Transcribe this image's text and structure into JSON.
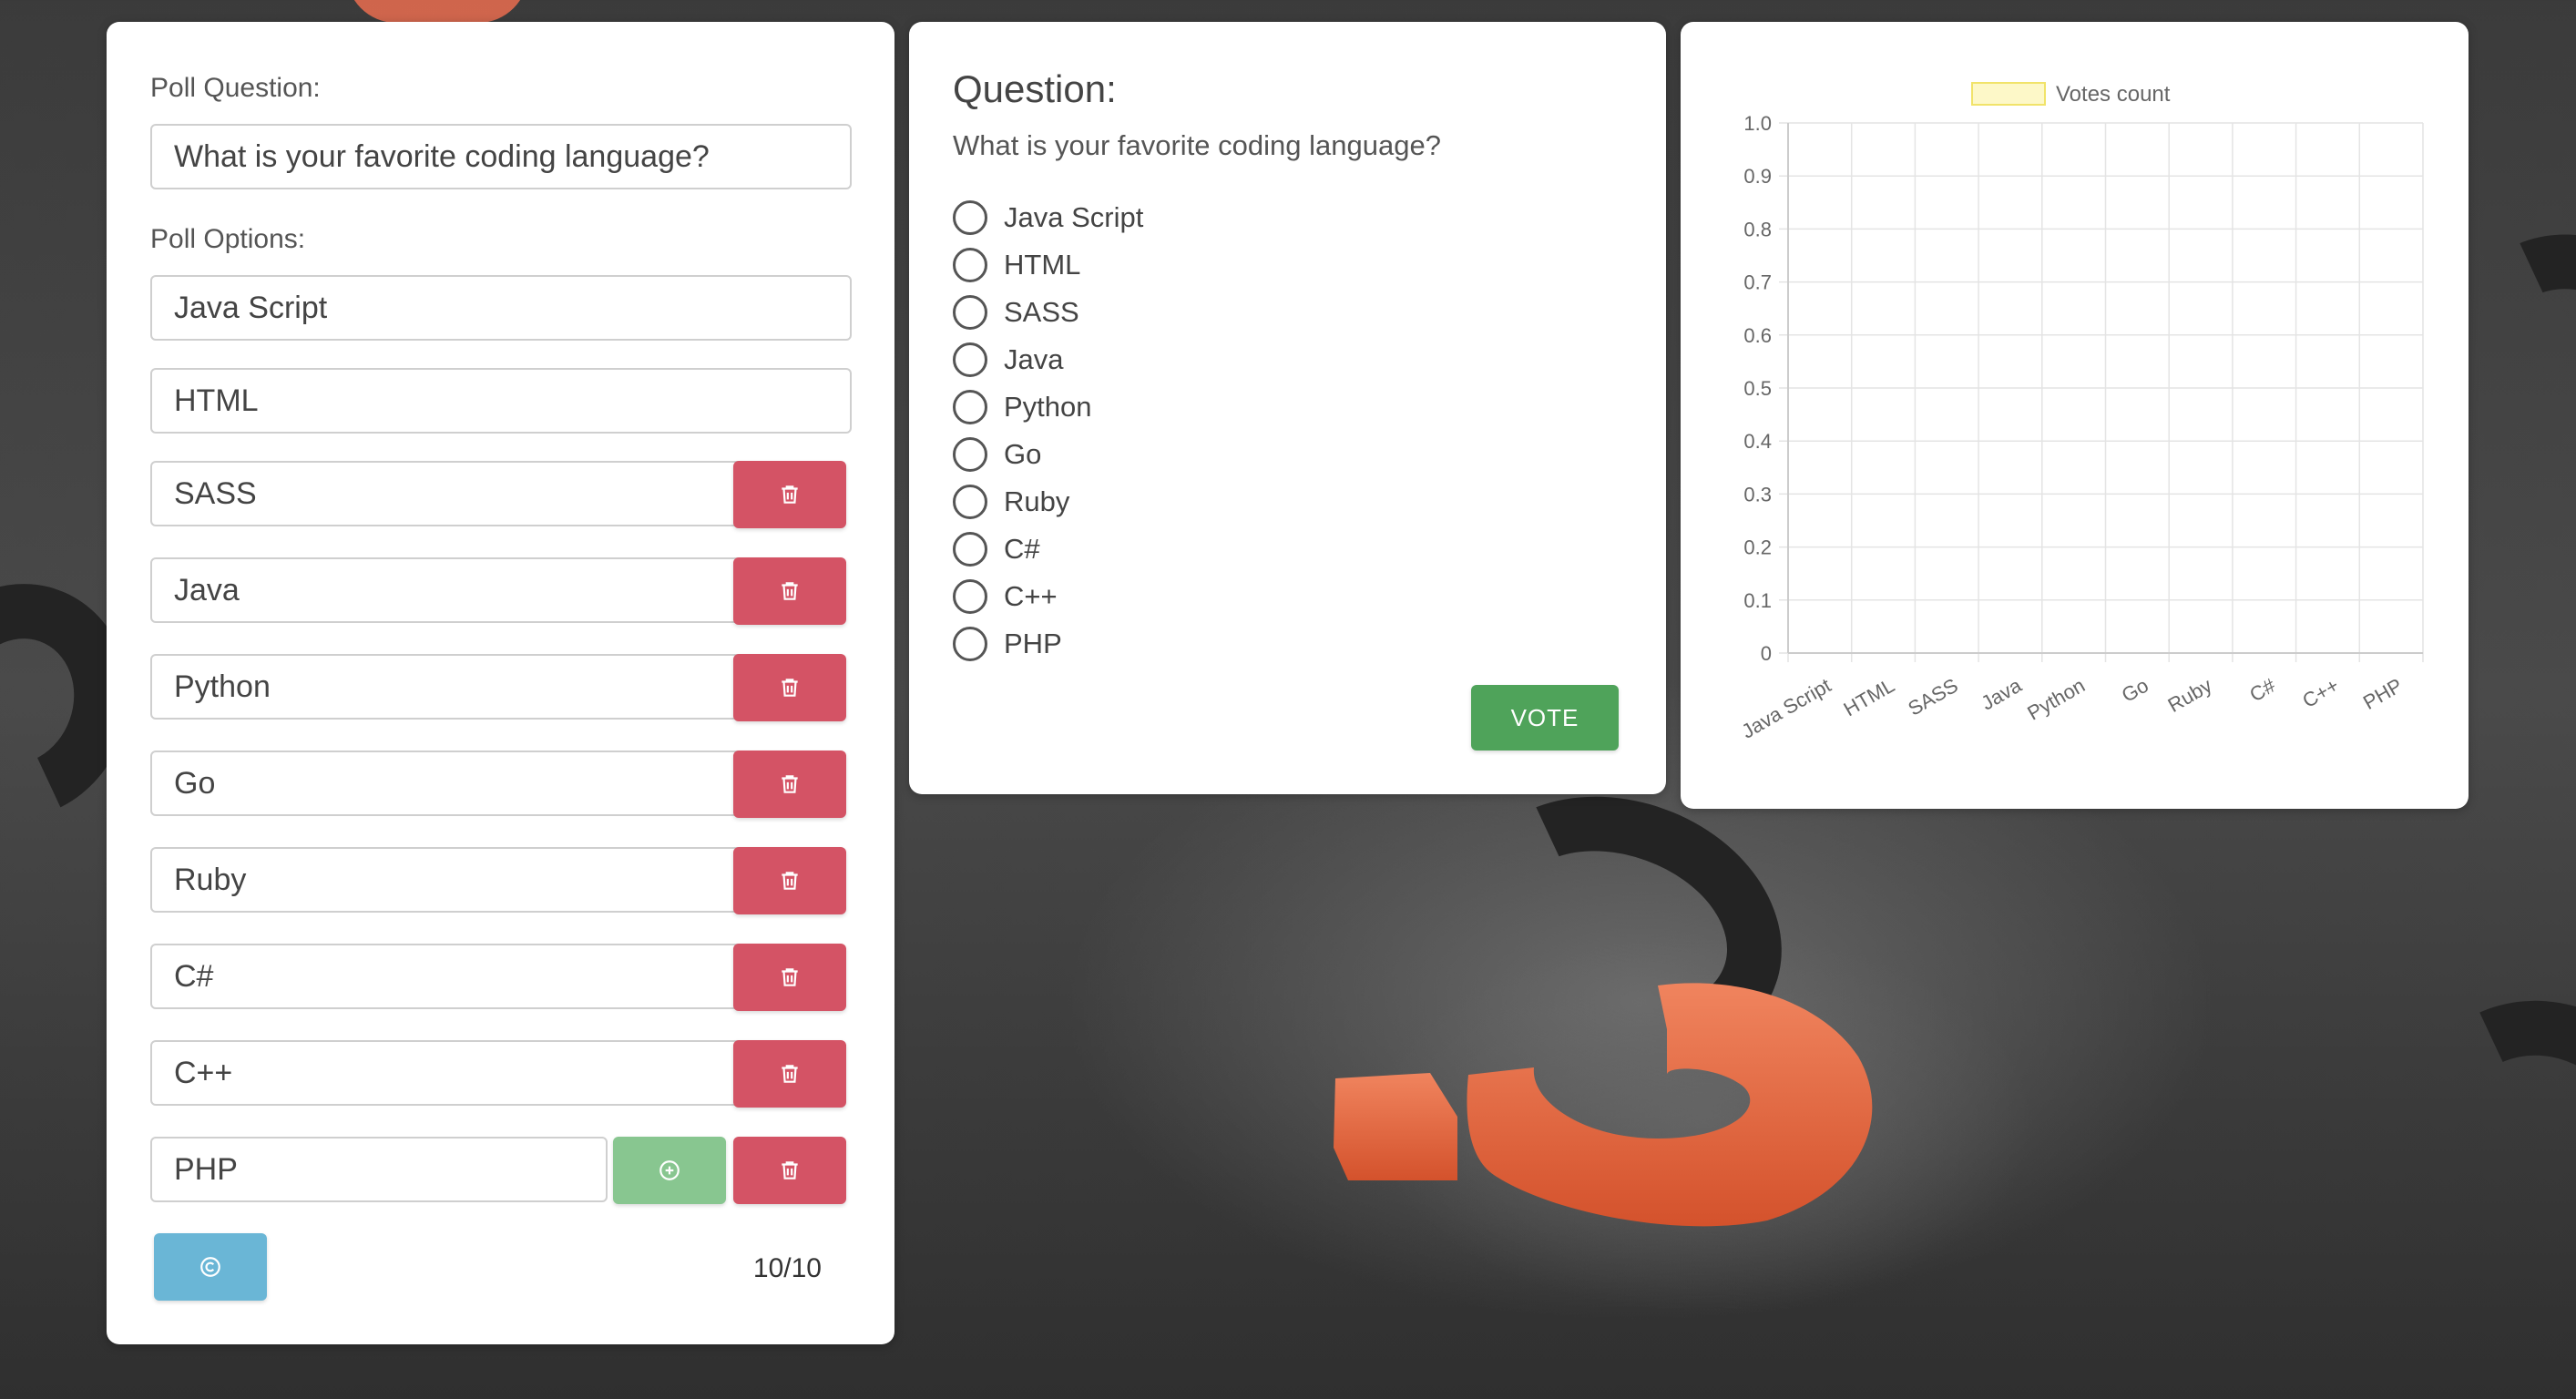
{
  "editor": {
    "question_label": "Poll Question:",
    "question_value": "What is your favorite coding language?",
    "options_label": "Poll Options:",
    "options": [
      "Java Script",
      "HTML",
      "SASS",
      "Java",
      "Python",
      "Go",
      "Ruby",
      "C#",
      "C++",
      "PHP"
    ],
    "count": "10/10"
  },
  "preview": {
    "heading": "Question:",
    "question": "What is your favorite coding language?",
    "options": [
      "Java Script",
      "HTML",
      "SASS",
      "Java",
      "Python",
      "Go",
      "Ruby",
      "C#",
      "C++",
      "PHP"
    ],
    "vote_label": "VOTE"
  },
  "icons": {
    "delete": "trash-icon",
    "add": "plus-circle-icon",
    "reset": "copyright-icon"
  },
  "colors": {
    "delete": "#d45365",
    "add": "#88c690",
    "reset": "#6ab6d6",
    "vote": "#4fa35a",
    "legend_fill": "#fdf8c8",
    "legend_border": "#f1e36a"
  },
  "chart_data": {
    "type": "bar",
    "categories": [
      "Java Script",
      "HTML",
      "SASS",
      "Java",
      "Python",
      "Go",
      "Ruby",
      "C#",
      "C++",
      "PHP"
    ],
    "series": [
      {
        "name": "Votes count",
        "values": [
          0,
          0,
          0,
          0,
          0,
          0,
          0,
          0,
          0,
          0
        ]
      }
    ],
    "ylim": [
      0,
      1.0
    ],
    "yticks": [
      "0",
      "0.1",
      "0.2",
      "0.3",
      "0.4",
      "0.5",
      "0.6",
      "0.7",
      "0.8",
      "0.9",
      "1.0"
    ],
    "grid": true,
    "legend": "top-center"
  }
}
